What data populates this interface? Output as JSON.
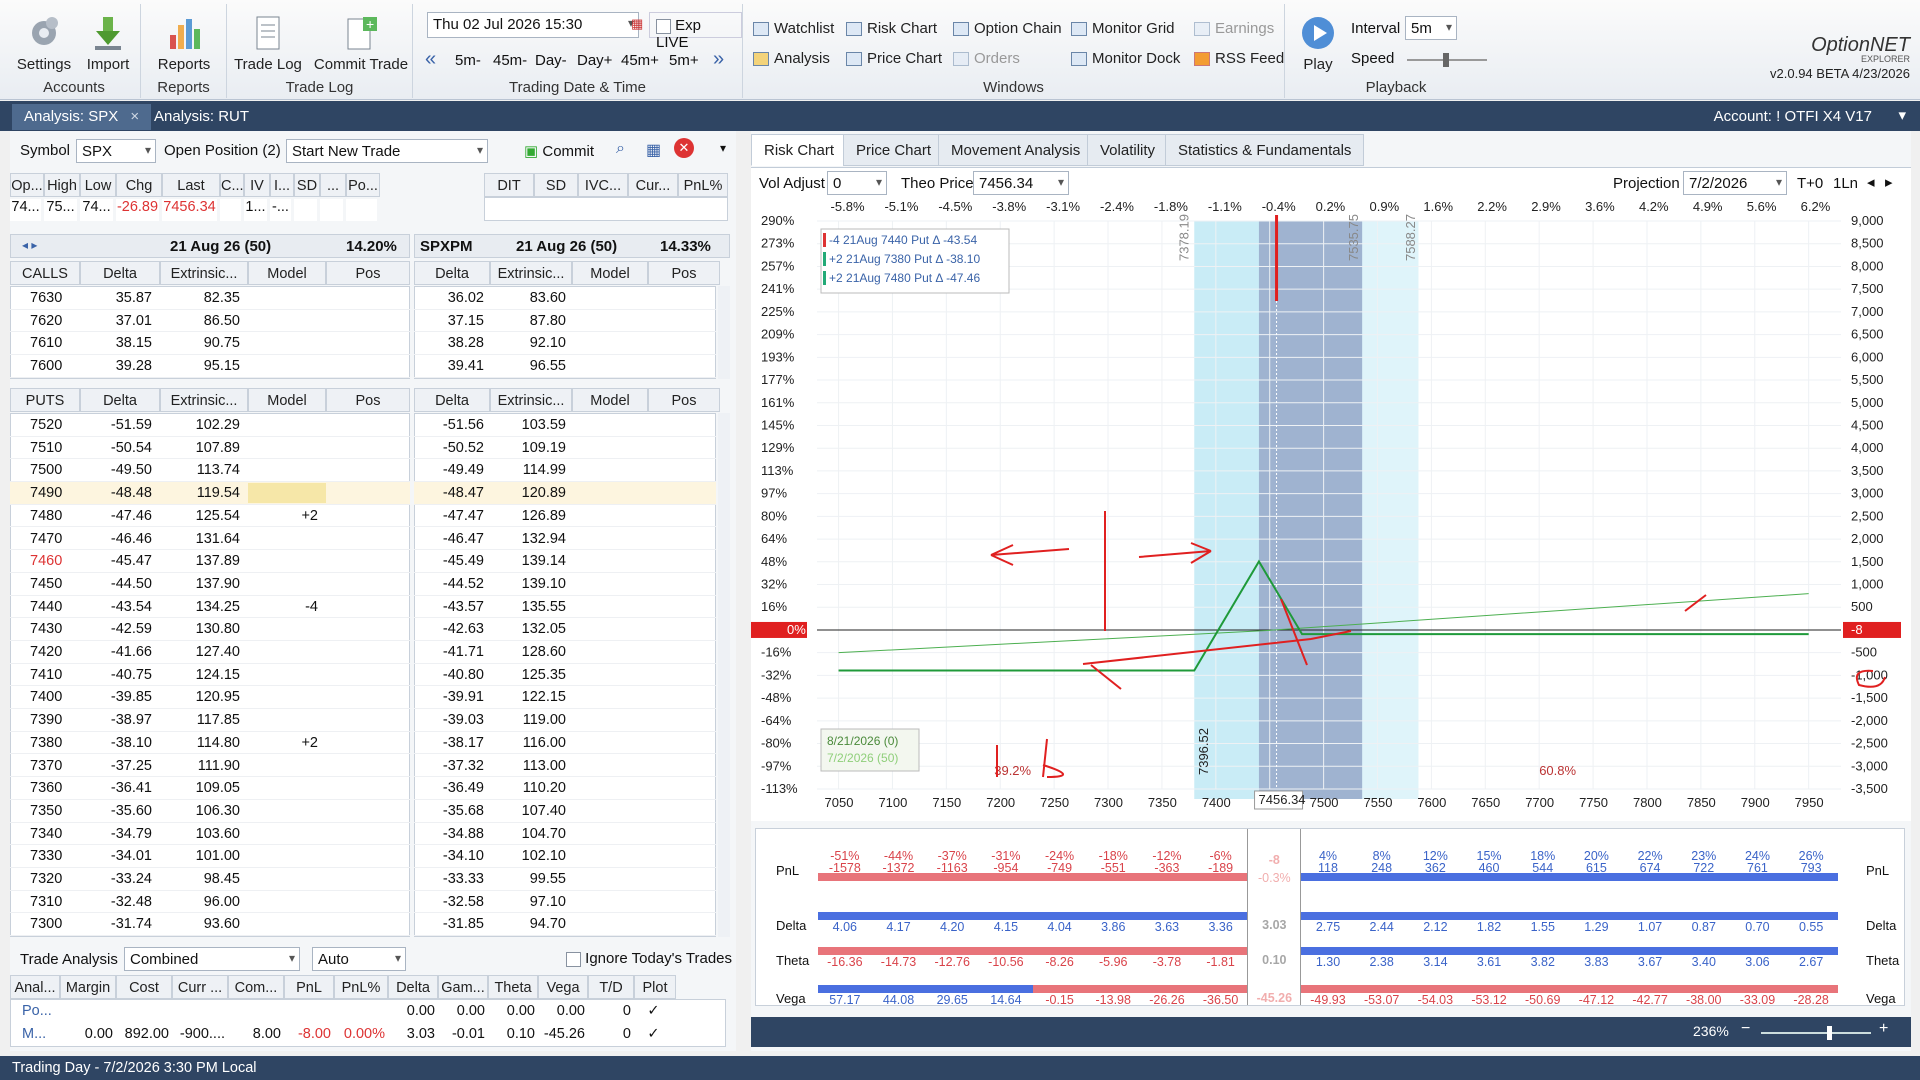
{
  "ribbon": {
    "accounts": {
      "settings": "Settings",
      "import": "Import",
      "title": "Accounts"
    },
    "reports": {
      "reports": "Reports",
      "title": "Reports"
    },
    "tradelog": {
      "trade_log": "Trade Log",
      "commit_trade": "Commit Trade",
      "title": "Trade Log"
    },
    "datetime": {
      "value": "Thu 02 Jul 2026 15:30",
      "exp_live": "Exp LIVE",
      "steps": [
        "5m-",
        "45m-",
        "Day-",
        "Day+",
        "45m+",
        "5m+"
      ],
      "title": "Trading Date & Time"
    },
    "windows": {
      "watchlist": "Watchlist",
      "risk_chart": "Risk Chart",
      "option_chain": "Option Chain",
      "monitor_grid": "Monitor Grid",
      "earnings": "Earnings",
      "analysis": "Analysis",
      "price_chart": "Price Chart",
      "orders": "Orders",
      "monitor_dock": "Monitor Dock",
      "rss_feed": "RSS Feed",
      "title": "Windows"
    },
    "playback": {
      "play": "Play",
      "interval_label": "Interval",
      "interval_value": "5m",
      "speed_label": "Speed",
      "title": "Playback"
    },
    "brand": {
      "name": "OptionNET",
      "sub": "EXPLORER",
      "version": "v2.0.94 BETA 4/23/2026"
    }
  },
  "doc_tabs": [
    {
      "label": "Analysis: SPX",
      "close": "×"
    },
    {
      "label": "Analysis: RUT"
    }
  ],
  "account": "Account: ! OTFI X4 V17",
  "left": {
    "symbol_label": "Symbol",
    "symbol": "SPX",
    "open_pos_label": "Open Position (2)",
    "trade_select": "Start New Trade",
    "commit": "Commit",
    "quote_headers": [
      "Op...",
      "High",
      "Low",
      "Chg",
      "Last",
      "C...",
      "IV",
      "I...",
      "SD",
      "...",
      "Po..."
    ],
    "quote_values": [
      "74...",
      "75...",
      "74...",
      "-26.89",
      "7456.34",
      "",
      "1...",
      "-...",
      "",
      ""
    ],
    "stat_headers": [
      "DIT",
      "SD",
      "IVC...",
      "Cur...",
      "PnL%"
    ],
    "exp_left": {
      "date": "21 Aug 26 (50)",
      "iv": "14.20%"
    },
    "exp_right": {
      "sym": "SPXPM",
      "date": "21 Aug 26 (50)",
      "iv": "14.33%"
    },
    "col_headers": [
      "Delta",
      "Extrinsic...",
      "Model",
      "Pos"
    ],
    "calls_label": "CALLS",
    "puts_label": "PUTS",
    "calls": [
      {
        "strike": "7630",
        "d": "35.87",
        "e": "82.35",
        "d2": "36.02",
        "e2": "83.60"
      },
      {
        "strike": "7620",
        "d": "37.01",
        "e": "86.50",
        "d2": "37.15",
        "e2": "87.80"
      },
      {
        "strike": "7610",
        "d": "38.15",
        "e": "90.75",
        "d2": "38.28",
        "e2": "92.10"
      },
      {
        "strike": "7600",
        "d": "39.28",
        "e": "95.15",
        "d2": "39.41",
        "e2": "96.55"
      }
    ],
    "puts": [
      {
        "strike": "7520",
        "d": "-51.59",
        "e": "102.29",
        "m": "",
        "d2": "-51.56",
        "e2": "103.59"
      },
      {
        "strike": "7510",
        "d": "-50.54",
        "e": "107.89",
        "m": "",
        "d2": "-50.52",
        "e2": "109.19"
      },
      {
        "strike": "7500",
        "d": "-49.50",
        "e": "113.74",
        "m": "",
        "d2": "-49.49",
        "e2": "114.99"
      },
      {
        "strike": "7490",
        "d": "-48.48",
        "e": "119.54",
        "m": "",
        "d2": "-48.47",
        "e2": "120.89",
        "hl": true
      },
      {
        "strike": "7480",
        "d": "-47.46",
        "e": "125.54",
        "m": "+2",
        "d2": "-47.47",
        "e2": "126.89"
      },
      {
        "strike": "7470",
        "d": "-46.46",
        "e": "131.64",
        "m": "",
        "d2": "-46.47",
        "e2": "132.94"
      },
      {
        "strike": "7460",
        "d": "-45.47",
        "e": "137.89",
        "m": "",
        "d2": "-45.49",
        "e2": "139.14",
        "red": true
      },
      {
        "strike": "7450",
        "d": "-44.50",
        "e": "137.90",
        "m": "",
        "d2": "-44.52",
        "e2": "139.10"
      },
      {
        "strike": "7440",
        "d": "-43.54",
        "e": "134.25",
        "m": "-4",
        "d2": "-43.57",
        "e2": "135.55"
      },
      {
        "strike": "7430",
        "d": "-42.59",
        "e": "130.80",
        "m": "",
        "d2": "-42.63",
        "e2": "132.05"
      },
      {
        "strike": "7420",
        "d": "-41.66",
        "e": "127.40",
        "m": "",
        "d2": "-41.71",
        "e2": "128.60"
      },
      {
        "strike": "7410",
        "d": "-40.75",
        "e": "124.15",
        "m": "",
        "d2": "-40.80",
        "e2": "125.35"
      },
      {
        "strike": "7400",
        "d": "-39.85",
        "e": "120.95",
        "m": "",
        "d2": "-39.91",
        "e2": "122.15"
      },
      {
        "strike": "7390",
        "d": "-38.97",
        "e": "117.85",
        "m": "",
        "d2": "-39.03",
        "e2": "119.00"
      },
      {
        "strike": "7380",
        "d": "-38.10",
        "e": "114.80",
        "m": "+2",
        "d2": "-38.17",
        "e2": "116.00"
      },
      {
        "strike": "7370",
        "d": "-37.25",
        "e": "111.90",
        "m": "",
        "d2": "-37.32",
        "e2": "113.00"
      },
      {
        "strike": "7360",
        "d": "-36.41",
        "e": "109.05",
        "m": "",
        "d2": "-36.49",
        "e2": "110.20"
      },
      {
        "strike": "7350",
        "d": "-35.60",
        "e": "106.30",
        "m": "",
        "d2": "-35.68",
        "e2": "107.40"
      },
      {
        "strike": "7340",
        "d": "-34.79",
        "e": "103.60",
        "m": "",
        "d2": "-34.88",
        "e2": "104.70"
      },
      {
        "strike": "7330",
        "d": "-34.01",
        "e": "101.00",
        "m": "",
        "d2": "-34.10",
        "e2": "102.10"
      },
      {
        "strike": "7320",
        "d": "-33.24",
        "e": "98.45",
        "m": "",
        "d2": "-33.33",
        "e2": "99.55"
      },
      {
        "strike": "7310",
        "d": "-32.48",
        "e": "96.00",
        "m": "",
        "d2": "-32.58",
        "e2": "97.10"
      },
      {
        "strike": "7300",
        "d": "-31.74",
        "e": "93.60",
        "m": "",
        "d2": "-31.85",
        "e2": "94.70"
      }
    ],
    "trade_analysis_label": "Trade Analysis",
    "ta_mode": "Combined",
    "ta_auto": "Auto",
    "ignore_label": "Ignore Today's Trades",
    "ta_headers": [
      "Anal...",
      "Margin",
      "Cost",
      "Curr ...",
      "Com...",
      "PnL",
      "PnL%",
      "Delta",
      "Gam...",
      "Theta",
      "Vega",
      "T/D",
      "Plot"
    ],
    "ta_rows": [
      [
        "Po...",
        "",
        "",
        "",
        "",
        "",
        "",
        "0.00",
        "0.00",
        "0.00",
        "0.00",
        "0",
        "✓"
      ],
      [
        "M...",
        "0.00",
        "892.00",
        "-900....",
        "8.00",
        "-8.00",
        "0.00%",
        "3.03",
        "-0.01",
        "0.10",
        "-45.26",
        "0",
        "✓"
      ]
    ]
  },
  "right": {
    "tabs": [
      "Risk Chart",
      "Price Chart",
      "Movement Analysis",
      "Volatility",
      "Statistics & Fundamentals"
    ],
    "vol_adjust_label": "Vol Adjust",
    "vol_adjust": "0",
    "theo_label": "Theo Price",
    "theo": "7456.34",
    "projection_label": "Projection",
    "projection": "7/2/2026",
    "t0": "T+0",
    "lines": "1Ln",
    "zoom": "236%"
  },
  "chart_data": {
    "type": "line",
    "x_ticks": [
      "7050",
      "7100",
      "7150",
      "7200",
      "7250",
      "7300",
      "7350",
      "7400",
      "7450",
      "7500",
      "7550",
      "7600",
      "7650",
      "7700",
      "7750",
      "7800",
      "7850",
      "7900",
      "7950"
    ],
    "current_price": "7456.34",
    "top_pct": [
      "-5.8%",
      "-5.1%",
      "-4.5%",
      "-3.8%",
      "-3.1%",
      "-2.4%",
      "-1.8%",
      "-1.1%",
      "-0.4%",
      "0.2%",
      "0.9%",
      "1.6%",
      "2.2%",
      "2.9%",
      "3.6%",
      "4.2%",
      "4.9%",
      "5.6%",
      "6.2%"
    ],
    "left_pct": [
      "290%",
      "273%",
      "257%",
      "241%",
      "225%",
      "209%",
      "193%",
      "177%",
      "161%",
      "145%",
      "129%",
      "113%",
      "97%",
      "80%",
      "64%",
      "48%",
      "32%",
      "16%",
      "0%",
      "-16%",
      "-32%",
      "-48%",
      "-64%",
      "-80%",
      "-97%",
      "-113%"
    ],
    "right_vals": [
      "9,000",
      "8,500",
      "8,000",
      "7,500",
      "7,000",
      "6,500",
      "6,000",
      "5,500",
      "5,000",
      "4,500",
      "4,000",
      "3,500",
      "3,000",
      "2,500",
      "2,000",
      "1,500",
      "1,000",
      "500",
      "-8",
      "-500",
      "-1,000",
      "-1,500",
      "-2,000",
      "-2,500",
      "-3,000",
      "-3,500"
    ],
    "legend": [
      {
        "text": "-4 21Aug 7440 Put Δ  -43.54",
        "color": "#d33"
      },
      {
        "text": "+2 21Aug 7380 Put Δ  -38.10",
        "color": "#2a7"
      },
      {
        "text": "+2 21Aug 7480 Put Δ  -47.46",
        "color": "#2a7"
      }
    ],
    "date_labels": [
      "8/21/2026 (0)",
      "7/2/2026 (50)"
    ],
    "vlabels": [
      "7378.19",
      "7535.75",
      "7588.27",
      "7396.52"
    ],
    "pct_labels": [
      "39.2%",
      "60.8%"
    ],
    "expiration_series": {
      "name": "8/21/2026 (0)",
      "x": [
        7050,
        7380,
        7440,
        7480,
        7550,
        7950
      ],
      "y": [
        -892,
        -892,
        1508,
        -92,
        -92,
        -92
      ]
    },
    "today_series": {
      "name": "7/2/2026 (50)",
      "x": [
        7050,
        7450,
        7950
      ],
      "y": [
        -500,
        -8,
        800
      ]
    },
    "greek_rows": [
      {
        "name": "PnL",
        "top": [
          "-51%",
          "-44%",
          "-37%",
          "-31%",
          "-24%",
          "-18%",
          "-12%",
          "-6%",
          "",
          "4%",
          "8%",
          "12%",
          "15%",
          "18%",
          "20%",
          "22%",
          "23%",
          "24%",
          "26%"
        ],
        "vals": [
          "-1578",
          "-1372",
          "-1163",
          "-954",
          "-749",
          "-551",
          "-363",
          "-189",
          "",
          "118",
          "248",
          "362",
          "460",
          "544",
          "615",
          "674",
          "722",
          "761",
          "793"
        ],
        "center": "-8",
        "center2": "-0.3%"
      },
      {
        "name": "Delta",
        "vals": [
          "4.06",
          "4.17",
          "4.20",
          "4.15",
          "4.04",
          "3.86",
          "3.63",
          "3.36",
          "",
          "2.75",
          "2.44",
          "2.12",
          "1.82",
          "1.55",
          "1.29",
          "1.07",
          "0.87",
          "0.70",
          "0.55"
        ],
        "center": "3.03"
      },
      {
        "name": "Theta",
        "vals": [
          "-16.36",
          "-14.73",
          "-12.76",
          "-10.56",
          "-8.26",
          "-5.96",
          "-3.78",
          "-1.81",
          "",
          "1.30",
          "2.38",
          "3.14",
          "3.61",
          "3.82",
          "3.83",
          "3.67",
          "3.40",
          "3.06",
          "2.67"
        ],
        "center": "0.10"
      },
      {
        "name": "Vega",
        "vals": [
          "57.17",
          "44.08",
          "29.65",
          "14.64",
          "-0.15",
          "-13.98",
          "-26.26",
          "-36.50",
          "",
          "-49.93",
          "-53.07",
          "-54.03",
          "-53.12",
          "-50.69",
          "-47.12",
          "-42.77",
          "-38.00",
          "-33.09",
          "-28.28"
        ],
        "center": "-45.26"
      }
    ]
  },
  "status": "Trading Day - 7/2/2026 3:30 PM Local"
}
